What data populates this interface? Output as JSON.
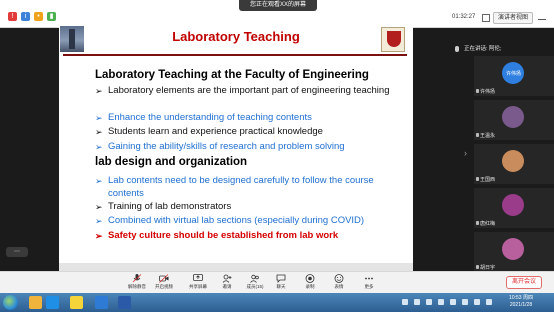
{
  "top_bar": {
    "sharing_banner": "您正在观看XX的屏幕",
    "timer": "01:32:27",
    "presenter_view_label": "演讲者视图"
  },
  "slide": {
    "title": "Laboratory Teaching",
    "section1_heading": "Laboratory Teaching at the Faculty of Engineering",
    "section1_bullets": [
      {
        "text": "Laboratory elements are the important part of engineering teaching",
        "style": "black",
        "marker": "➢"
      },
      {
        "text": "Enhance the understanding of teaching contents",
        "style": "blue",
        "marker": "➢"
      },
      {
        "text": "Students learn and experience practical knowledge",
        "style": "black",
        "marker": "➢"
      },
      {
        "text": "Gaining the ability/skills of research and problem solving",
        "style": "blue",
        "marker": "➢"
      }
    ],
    "section2_heading": "lab design and organization",
    "section2_bullets": [
      {
        "text": "Lab contents need to be designed carefully to follow the course contents",
        "style": "blue",
        "marker": "➢"
      },
      {
        "text": "Training of lab demonstrators",
        "style": "black",
        "marker": "➢"
      },
      {
        "text": "Combined with virtual lab sections (especially during COVID)",
        "style": "blue",
        "marker": "➢"
      },
      {
        "text": "Safety culture should be established from lab work",
        "style": "red",
        "marker": "➢"
      }
    ]
  },
  "participants": {
    "speaking_label": "正在讲话: 阿伦;",
    "tiles": [
      {
        "name": "许伟扬",
        "tile_text": "许伟扬",
        "color": "#2f7fe0"
      },
      {
        "name": "王温永",
        "tile_text": "",
        "color": "#7a5a8c"
      },
      {
        "name": "王国西",
        "tile_text": "",
        "color": "#c98c5c"
      },
      {
        "name": "唐红梅",
        "tile_text": "",
        "color": "#9a3c8a"
      },
      {
        "name": "胡日宇",
        "tile_text": "",
        "color": "#b85f9e"
      }
    ]
  },
  "toolbar": {
    "items": [
      {
        "label": "解除静音",
        "icon": "microphone-icon"
      },
      {
        "label": "开启视频",
        "icon": "camera-icon"
      },
      {
        "label": "共享屏幕",
        "icon": "share-screen-icon"
      },
      {
        "label": "邀请",
        "icon": "invite-icon"
      },
      {
        "label": "成员(15)",
        "icon": "members-icon"
      },
      {
        "label": "聊天",
        "icon": "chat-icon"
      },
      {
        "label": "录制",
        "icon": "record-icon"
      },
      {
        "label": "表情",
        "icon": "emoji-icon"
      },
      {
        "label": "更多",
        "icon": "more-icon"
      }
    ],
    "leave_label": "离开会议"
  },
  "taskbar": {
    "time": "10:53 周四",
    "date": "2021/1/28"
  }
}
